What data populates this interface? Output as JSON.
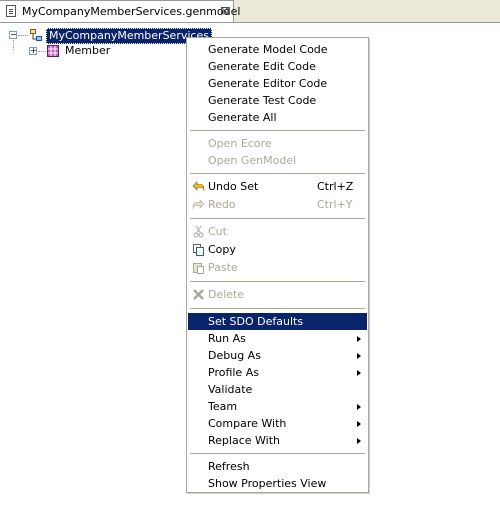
{
  "tab": {
    "title": "MyCompanyMemberServices.genmodel",
    "close": "⊠"
  },
  "tree": {
    "root_label": "MyCompanyMemberServices",
    "child_label": "Member",
    "root_toggle": "−",
    "child_toggle": "+"
  },
  "context_menu": {
    "generate_model_code": "Generate Model Code",
    "generate_edit_code": "Generate Edit Code",
    "generate_editor_code": "Generate Editor Code",
    "generate_test_code": "Generate Test Code",
    "generate_all": "Generate All",
    "open_ecore": "Open Ecore",
    "open_genmodel": "Open GenModel",
    "undo_set": "Undo Set",
    "undo_shortcut": "Ctrl+Z",
    "redo": "Redo",
    "redo_shortcut": "Ctrl+Y",
    "cut": "Cut",
    "copy": "Copy",
    "paste": "Paste",
    "delete": "Delete",
    "set_sdo_defaults": "Set SDO Defaults",
    "run_as": "Run As",
    "debug_as": "Debug As",
    "profile_as": "Profile As",
    "validate": "Validate",
    "team": "Team",
    "compare_with": "Compare With",
    "replace_with": "Replace With",
    "refresh": "Refresh",
    "show_properties_view": "Show Properties View"
  },
  "colors": {
    "selection": "#0a246a",
    "disabled_text": "#aca899"
  }
}
